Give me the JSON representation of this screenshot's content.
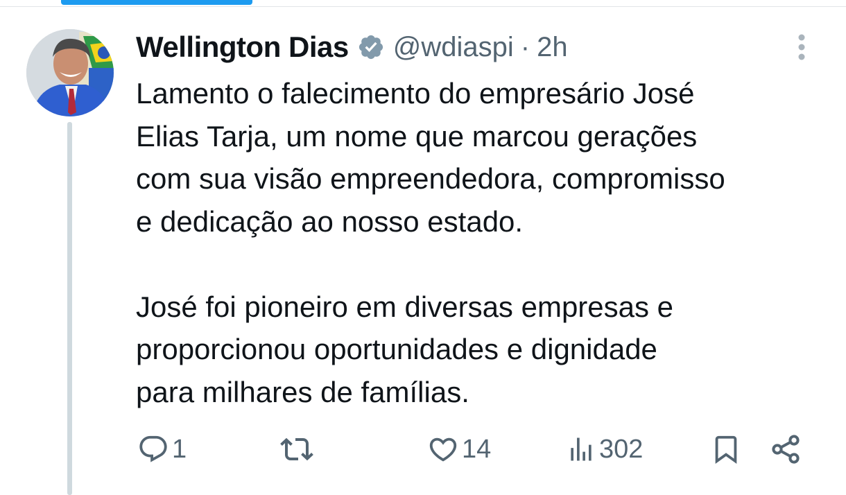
{
  "tweet": {
    "author": {
      "display_name": "Wellington Dias",
      "handle": "@wdiaspi",
      "verified": true
    },
    "separator": "·",
    "timestamp": "2h",
    "text_lines": [
      "Lamento o falecimento do empresário José",
      "Elias Tarja, um nome que marcou gerações",
      "com sua visão empreendedora, compromisso",
      "e dedicação ao nosso estado.",
      "",
      "José foi pioneiro em diversas empresas e",
      "proporcionou oportunidades e dignidade",
      "para milhares de famílias."
    ],
    "actions": {
      "replies": "1",
      "retweets": "",
      "likes": "14",
      "views": "302"
    }
  },
  "icons": {
    "verified": "verified-badge-icon",
    "more": "more-vertical-icon",
    "reply": "reply-icon",
    "retweet": "retweet-icon",
    "like": "heart-icon",
    "views": "bar-chart-icon",
    "bookmark": "bookmark-icon",
    "share": "share-icon"
  },
  "colors": {
    "text": "#0f1419",
    "muted": "#536471",
    "accent": "#1d9bf0",
    "thread_line": "#cfd9de"
  }
}
